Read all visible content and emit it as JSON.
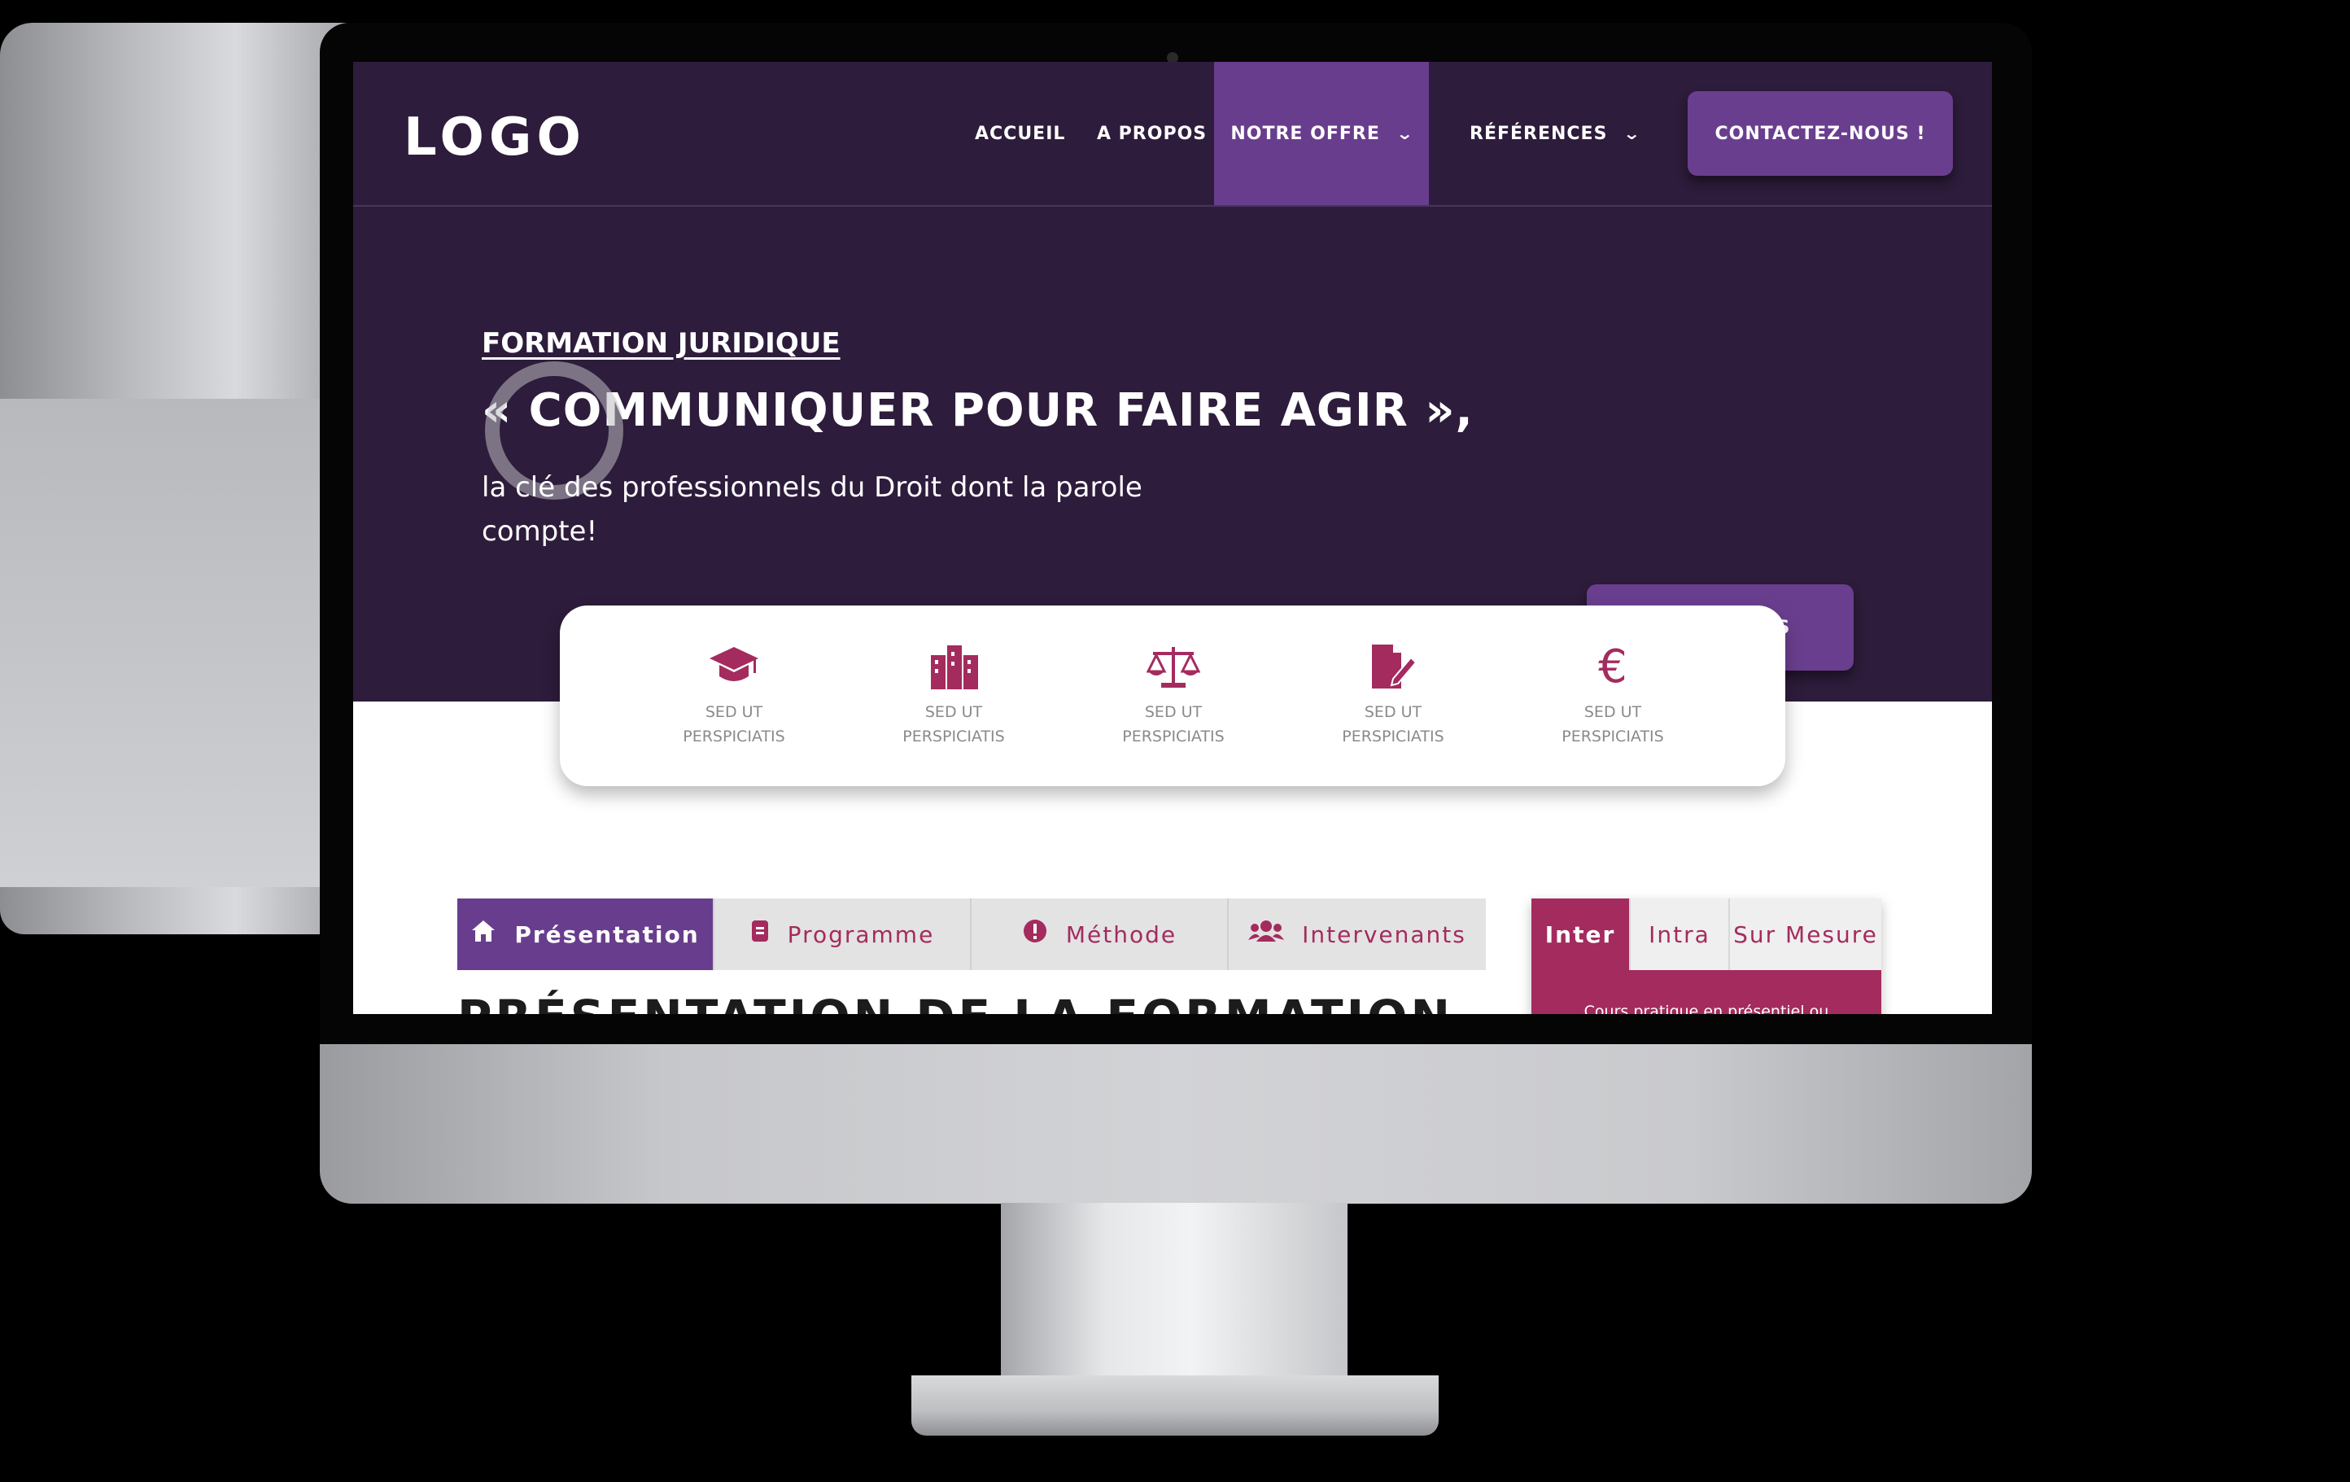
{
  "nav": {
    "logo": "LOGO",
    "items": [
      {
        "label": "ACCUEIL"
      },
      {
        "label": "A PROPOS"
      },
      {
        "label": "NOTRE OFFRE",
        "active": true
      },
      {
        "label": "RÉFÉRENCES"
      }
    ],
    "contact_label": "CONTACTEZ-NOUS !"
  },
  "hero": {
    "eyebrow": "FORMATION JURIDIQUE",
    "title": "« COMMUNIQUER POUR FAIRE AGIR »,",
    "subtitle": "la clé des professionnels du Droit dont la parole compte!",
    "cta_label": "JE M’INSCRIS"
  },
  "features": [
    {
      "icon": "graduation-cap-icon",
      "label": "SED UT PERSPICIATIS"
    },
    {
      "icon": "building-icon",
      "label": "SED UT PERSPICIATIS"
    },
    {
      "icon": "scales-icon",
      "label": "SED UT PERSPICIATIS"
    },
    {
      "icon": "document-signature-icon",
      "label": "SED UT PERSPICIATIS"
    },
    {
      "icon": "euro-icon",
      "label": "SED UT PERSPICIATIS"
    }
  ],
  "tabs": [
    {
      "icon": "home-icon",
      "label": "Présentation",
      "active": true
    },
    {
      "icon": "document-icon",
      "label": "Programme"
    },
    {
      "icon": "alert-icon",
      "label": "Méthode"
    },
    {
      "icon": "users-icon",
      "label": "Intervenants"
    }
  ],
  "section_title": "PRÉSENTATION DE LA FORMATION",
  "pricing": {
    "tabs": [
      {
        "label": "Inter",
        "active": true
      },
      {
        "label": "Intra"
      },
      {
        "label": "Sur Mesure"
      }
    ],
    "body_text": "Cours pratique en présentiel ou"
  },
  "colors": {
    "header_bg": "#2d1c3b",
    "accent_purple": "#693d8d",
    "accent_magenta": "#a42b5e",
    "tab_bg": "#e3e3e3"
  }
}
